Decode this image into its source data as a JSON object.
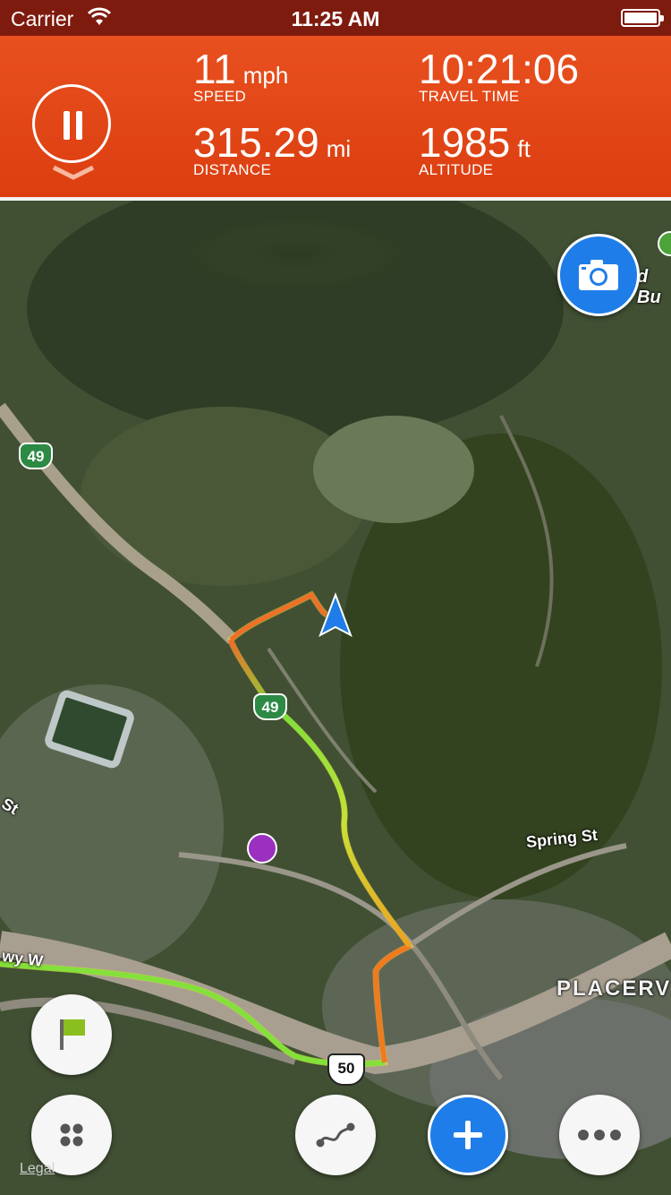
{
  "status_bar": {
    "carrier": "Carrier",
    "time": "11:25 AM"
  },
  "dashboard": {
    "speed": {
      "value": "11",
      "unit": "mph",
      "label": "SPEED"
    },
    "travel_time": {
      "value": "10:21:06",
      "label": "TRAVEL TIME"
    },
    "distance": {
      "value": "315.29",
      "unit": "mi",
      "label": "DISTANCE"
    },
    "altitude": {
      "value": "1985",
      "unit": "ft",
      "label": "ALTITUDE"
    }
  },
  "map": {
    "labels": {
      "spring_st": "Spring St",
      "placerville": "PLACERV",
      "hwy_w": "wy W",
      "st_left": "St",
      "top_right": "d Bu"
    },
    "shields": {
      "route49_top": "49",
      "route49_mid": "49",
      "us50": "50"
    },
    "legal": "Legal"
  },
  "buttons": {
    "pause": "pause-icon",
    "collapse": "chevron-down-icon",
    "camera": "camera-icon",
    "flag": "flag-icon",
    "grid": "grid-icon",
    "route": "route-icon",
    "add": "plus-icon",
    "more": "ellipsis-icon"
  },
  "colors": {
    "header": "#e2461a",
    "accent_blue": "#1e7de8",
    "flag_green": "#8bbe1f"
  }
}
